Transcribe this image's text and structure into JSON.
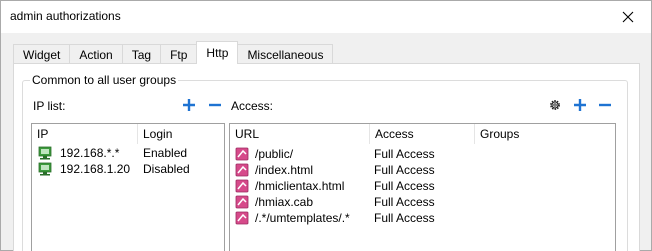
{
  "window": {
    "title": "admin authorizations"
  },
  "tabs": [
    {
      "label": "Widget",
      "active": false
    },
    {
      "label": "Action",
      "active": false
    },
    {
      "label": "Tag",
      "active": false
    },
    {
      "label": "Ftp",
      "active": false
    },
    {
      "label": "Http",
      "active": true
    },
    {
      "label": "Miscellaneous",
      "active": false
    }
  ],
  "group": {
    "title": "Common to all user groups"
  },
  "ip_list": {
    "label": "IP list:",
    "columns": [
      "IP",
      "Login"
    ],
    "rows": [
      {
        "ip": "192.168.*.*",
        "login": "Enabled"
      },
      {
        "ip": "192.168.1.20",
        "login": "Disabled"
      }
    ]
  },
  "access": {
    "label": "Access:",
    "columns": [
      "URL",
      "Access",
      "Groups"
    ],
    "rows": [
      {
        "url": "/public/",
        "access": "Full Access",
        "groups": ""
      },
      {
        "url": "/index.html",
        "access": "Full Access",
        "groups": ""
      },
      {
        "url": "/hmiclientax.html",
        "access": "Full Access",
        "groups": ""
      },
      {
        "url": "/hmiax.cab",
        "access": "Full Access",
        "groups": ""
      },
      {
        "url": "/.*/umtemplates/.*",
        "access": "Full Access",
        "groups": ""
      }
    ]
  },
  "colors": {
    "accent_blue": "#1e73d2",
    "network_icon": "#3c9a3c",
    "page_icon": "#d64a8a"
  }
}
